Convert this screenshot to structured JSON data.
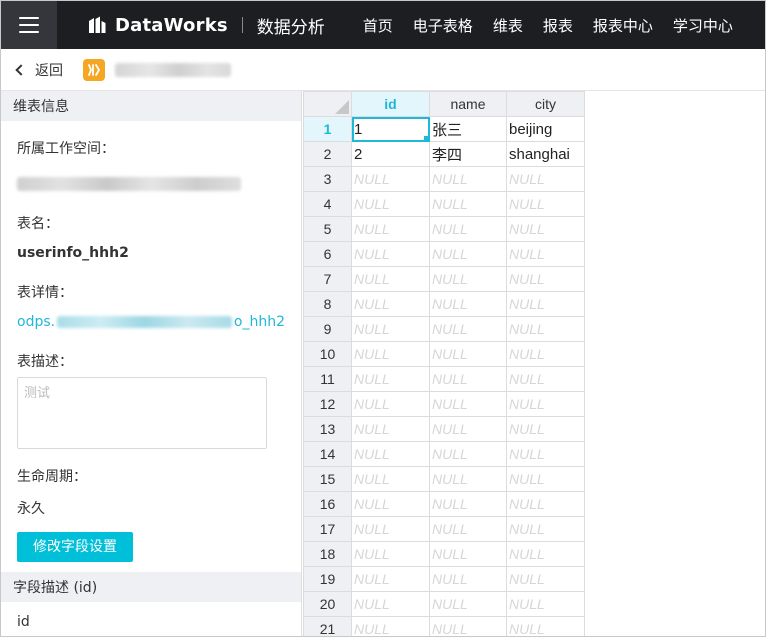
{
  "topbar": {
    "brand": "DataWorks",
    "product": "数据分析",
    "nav": [
      "首页",
      "电子表格",
      "维表",
      "报表",
      "报表中心",
      "学习中心"
    ]
  },
  "back": {
    "label": "返回"
  },
  "left": {
    "section_title": "维表信息",
    "workspace_label": "所属工作空间：",
    "table_name_label": "表名：",
    "table_name": "userinfo_hhh2",
    "detail_label": "表详情：",
    "detail_prefix": "odps.",
    "detail_suffix": "o_hhh2",
    "desc_label": "表描述：",
    "desc_placeholder": "测试",
    "lifecycle_label": "生命周期：",
    "lifecycle_value": "永久",
    "edit_button": "修改字段设置",
    "field_section_title": "字段描述 (id)",
    "field_name": "id"
  },
  "grid": {
    "columns": [
      "id",
      "name",
      "city"
    ],
    "rows": [
      [
        "1",
        "张三",
        "beijing"
      ],
      [
        "2",
        "李四",
        "shanghai"
      ]
    ],
    "row_numbers": [
      "1",
      "2",
      "3",
      "4",
      "5",
      "6",
      "7",
      "8",
      "9",
      "10",
      "11",
      "12",
      "13",
      "14",
      "15",
      "16",
      "17",
      "18",
      "19",
      "20",
      "21"
    ],
    "null_text": "NULL"
  }
}
